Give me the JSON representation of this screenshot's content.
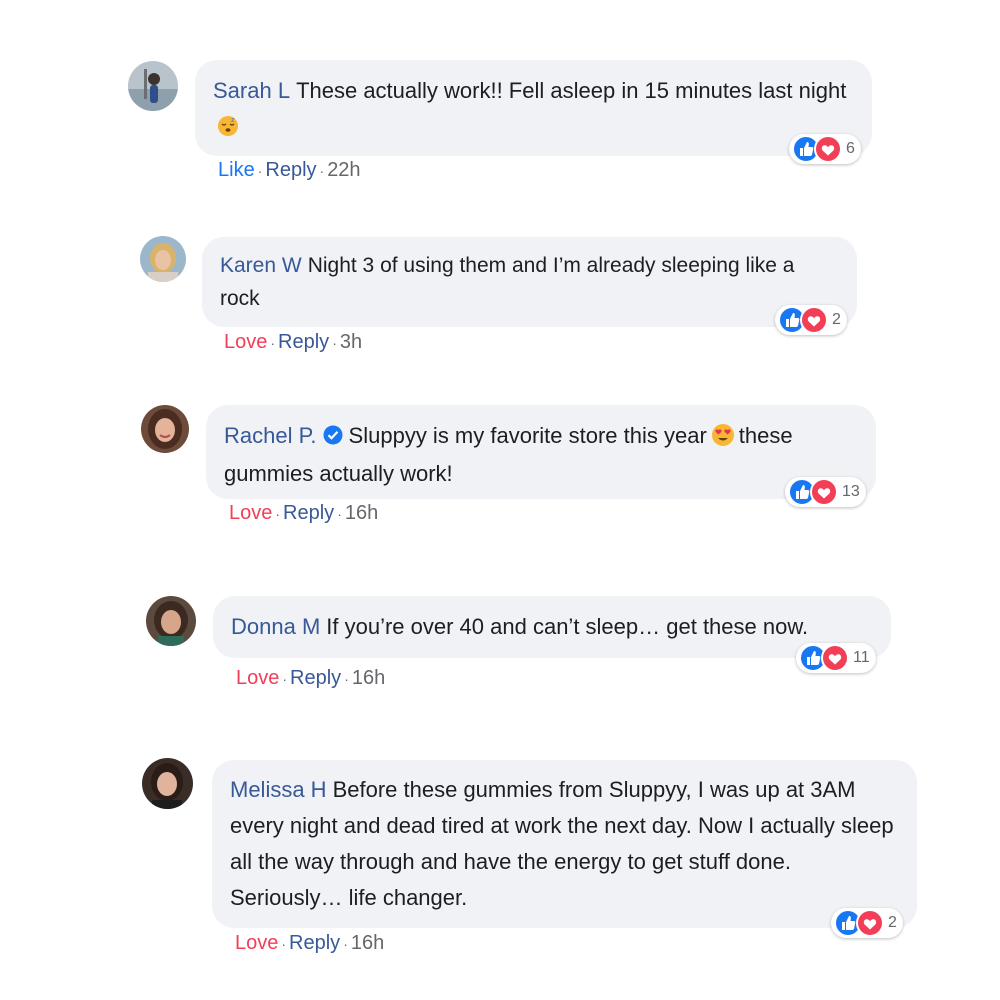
{
  "comments": [
    {
      "author": "Sarah L",
      "text_before": "These actually work!! Fell asleep in 15 minutes last night",
      "text_after": "",
      "emoji": "sleepy-face-emoji",
      "action1": "Like",
      "reply": "Reply",
      "time": "22h",
      "reaction_count": "6",
      "verified": false
    },
    {
      "author": "Karen W",
      "text_before": "Night 3 of using them and I’m already sleeping like a rock",
      "text_after": "",
      "emoji": "",
      "action1": "Love",
      "reply": "Reply",
      "time": "3h",
      "reaction_count": "2",
      "verified": false
    },
    {
      "author": "Rachel P.",
      "text_before": "Sluppyy is my favorite store this year",
      "text_after": "these gummies actually work!",
      "emoji": "heart-eyes-emoji",
      "action1": "Love",
      "reply": "Reply",
      "time": "16h",
      "reaction_count": "13",
      "verified": true
    },
    {
      "author": "Donna M",
      "text_before": "If you’re over 40 and can’t sleep… get these now.",
      "text_after": "",
      "emoji": "",
      "action1": "Love",
      "reply": "Reply",
      "time": "16h",
      "reaction_count": "11",
      "verified": false
    },
    {
      "author": "Melissa H",
      "text_before": "Before these gummies from Sluppyy, I was up at 3AM every night and dead tired at work the next day. Now I actually sleep all the way through and have the energy to get stuff done. Seriously… life changer.",
      "text_after": "",
      "emoji": "",
      "action1": "Love",
      "reply": "Reply",
      "time": "16h",
      "reaction_count": "2",
      "verified": false
    }
  ],
  "colors": {
    "bubble": "#f0f2f5",
    "author": "#385898",
    "like": "#1877f2",
    "love": "#f33e58"
  }
}
